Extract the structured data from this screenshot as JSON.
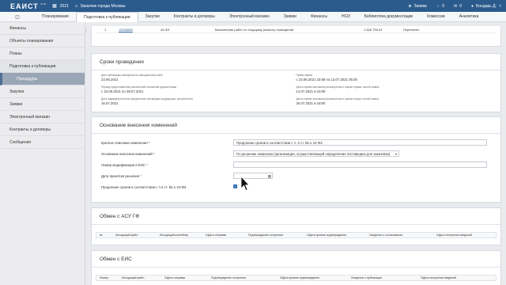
{
  "header": {
    "logo": "ЕАИСТ",
    "version": "v2.36",
    "year": "2021",
    "org": "Заказчик города Москвы",
    "requests_label": "Заявки",
    "notifications": "0",
    "messages": "0",
    "user": "Бондарь Д."
  },
  "nav": {
    "tabs": [
      "Планирование",
      "Подготовка к публикации",
      "Закупки",
      "Контракты и договоры",
      "Электронный магазин",
      "Заявки",
      "Финансы",
      "НСИ",
      "Библиотека документации",
      "Комиссии",
      "Аналитика"
    ]
  },
  "sidebar": {
    "items": [
      "Финансы",
      "Объекты планирования",
      "Планы",
      "Подготовка к публикации",
      "Процедуры",
      "Закупки",
      "Заявки",
      "Электронный магазин",
      "Контракты и договоры",
      "Сообщения"
    ]
  },
  "publication_row": {
    "num": "1",
    "id": "15036885",
    "law": "44-ФЗ",
    "subject": "Выполнение работ по текущему ремонту помещений",
    "amount": "1 628 755,03",
    "status": "Перенесен"
  },
  "deadlines": {
    "title": "Сроки проведения",
    "items": [
      {
        "label": "Дата публикации извещения на официальном сайте",
        "value": "23.06.2021"
      },
      {
        "label": "Приём заявок",
        "value": "с 23.06.2021 23:59 по 13.07.2021 05:00"
      },
      {
        "label": "Период предоставления разъяснений положений документации",
        "value": "с 23.06.2021 по 08.07.2021"
      },
      {
        "label": "Дата и время окончания рассмотрения и оценки первых частей заявок",
        "value": "14.07.2021 в 18:00"
      },
      {
        "label": "Дата подведения итогов определения поставщика (подрядчика, исполнителя)",
        "value": "16.07.2021"
      },
      {
        "label": "Дата и время окончания рассмотрения и оценки вторых частей заявок",
        "value": "20.07.2021 в 18:00"
      }
    ]
  },
  "change_basis": {
    "title": "Основание внесения изменений",
    "summary_label": "Краткое описание изменения",
    "summary_value": "Продление сроков в соответствии с ч. 3 ст. 55.1 44-ФЗ",
    "basis_label": "Основание внесения изменений",
    "basis_value": "По решению заказчика (организации, осуществляющей определение поставщика для заказчика)",
    "mod_number_label": "Номер модификации в ЕИС",
    "mod_number_value": "",
    "decision_date_label": "Дата принятия решения",
    "decision_date_value": "",
    "extension_label": "Продление сроков в соответствии с ч.3 ст. 55.1 44-ФЗ",
    "extension_checked": true
  },
  "asu_exchange": {
    "title": "Обмен с АСУ ГФ",
    "columns": [
      "№",
      "Исходящий файл",
      "Исходящий контейнер",
      "Дата отправки",
      "Подтверждение получения",
      "Дата приема подтверждения",
      "Сведения о согласовании",
      "Дата получения сведений"
    ]
  },
  "eis_exchange": {
    "title": "Обмен с ЕИС",
    "columns": [
      "Номер",
      "Исходящий файл",
      "Дата отправки",
      "Подтверждение получения",
      "Дата приема подтверждения",
      "Сведения о публикации",
      "Дата получения сведений"
    ]
  },
  "colors": {
    "topbar": "#2b5a8c",
    "active_sidebar": "#9aa6b5",
    "checkbox": "#2f6bb3"
  }
}
